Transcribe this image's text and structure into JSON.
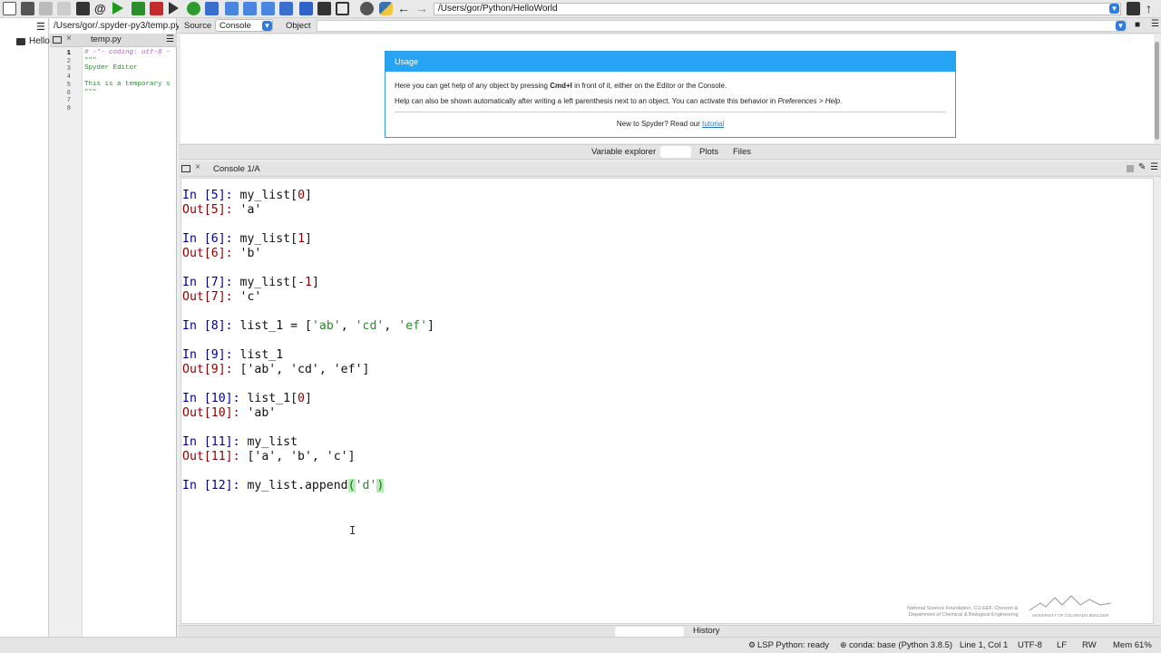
{
  "toolbar": {
    "working_dir": "/Users/gor/Python/HelloWorld",
    "icons": [
      "new-file-icon",
      "open-file-icon",
      "save-icon",
      "save-all-icon",
      "list-icon",
      "at-icon",
      "run-icon",
      "run-cell-icon",
      "run-cell-advance-icon",
      "run-selection-icon",
      "debug-icon",
      "step-icon",
      "step-into-icon",
      "step-return-icon",
      "continue-icon",
      "stop-icon",
      "maximize-icon",
      "fullscreen-icon",
      "wrench-icon",
      "python-path-icon",
      "back-arrow-icon",
      "forward-arrow-icon"
    ]
  },
  "file_explorer": {
    "item": "Hello"
  },
  "editor": {
    "path": "/Users/gor/.spyder-py3/temp.py",
    "tab": "temp.py",
    "line_numbers": [
      "1",
      "2",
      "3",
      "4",
      "5",
      "6",
      "7",
      "8"
    ],
    "lines": [
      "# -*- coding: utf-8 -",
      "\"\"\"",
      "Spyder Editor",
      "",
      "This is a temporary s",
      "\"\"\"",
      "",
      ""
    ]
  },
  "help": {
    "source_label": "Source",
    "source_value": "Console",
    "object_label": "Object",
    "usage_title": "Usage",
    "line1_pre": "Here you can get help of any object by pressing ",
    "line1_key": "Cmd+I",
    "line1_post": " in front of it, either on the Editor or the Console.",
    "line2_pre": "Help can also be shown automatically after writing a left parenthesis next to an object. You can activate this behavior in ",
    "line2_em": "Preferences > Help",
    "line2_post": ".",
    "line3_pre": "New to Spyder? Read our ",
    "line3_link": "tutorial"
  },
  "upper_tabs": [
    "Variable explorer",
    "",
    "Plots",
    "Files"
  ],
  "console": {
    "tab": "Console 1/A",
    "entries": [
      {
        "in_prompt": "In [5]: ",
        "code": "my_list[0]",
        "out_prompt": "Out[5]: ",
        "out": "'a'"
      },
      {
        "in_prompt": "In [6]: ",
        "code": "my_list[1]",
        "out_prompt": "Out[6]: ",
        "out": "'b'"
      },
      {
        "in_prompt": "In [7]: ",
        "code": "my_list[-1]",
        "out_prompt": "Out[7]: ",
        "out": "'c'"
      },
      {
        "in_prompt": "In [8]: ",
        "code": "list_1 = ['ab', 'cd', 'ef']"
      },
      {
        "in_prompt": "In [9]: ",
        "code": "list_1",
        "out_prompt": "Out[9]: ",
        "out": "['ab', 'cd', 'ef']"
      },
      {
        "in_prompt": "In [10]: ",
        "code": "list_1[0]",
        "out_prompt": "Out[10]: ",
        "out": "'ab'"
      },
      {
        "in_prompt": "In [11]: ",
        "code": "my_list",
        "out_prompt": "Out[11]: ",
        "out": "['a', 'b', 'c']"
      },
      {
        "in_prompt": "In [12]: ",
        "code": "my_list.append('d')"
      }
    ]
  },
  "lower_tabs": [
    "",
    "History"
  ],
  "watermark": {
    "line1": "National Science Foundation, CU-EEF, Chevron &",
    "line2": "Department of Chemical & Biological Engineering",
    "line3": "UNIVERSITY OF COLORADO BOULDER"
  },
  "status": {
    "lsp": "LSP Python: ready",
    "conda": "conda: base (Python 3.8.5)",
    "position": "Line 1, Col 1",
    "encoding": "UTF-8",
    "eol": "LF",
    "rw": "RW",
    "mem": "Mem 61%"
  },
  "colors": {
    "accent": "#27a4f4",
    "prompt_in": "#00008b",
    "prompt_out": "#8b0000",
    "string": "#2b8a2b"
  }
}
